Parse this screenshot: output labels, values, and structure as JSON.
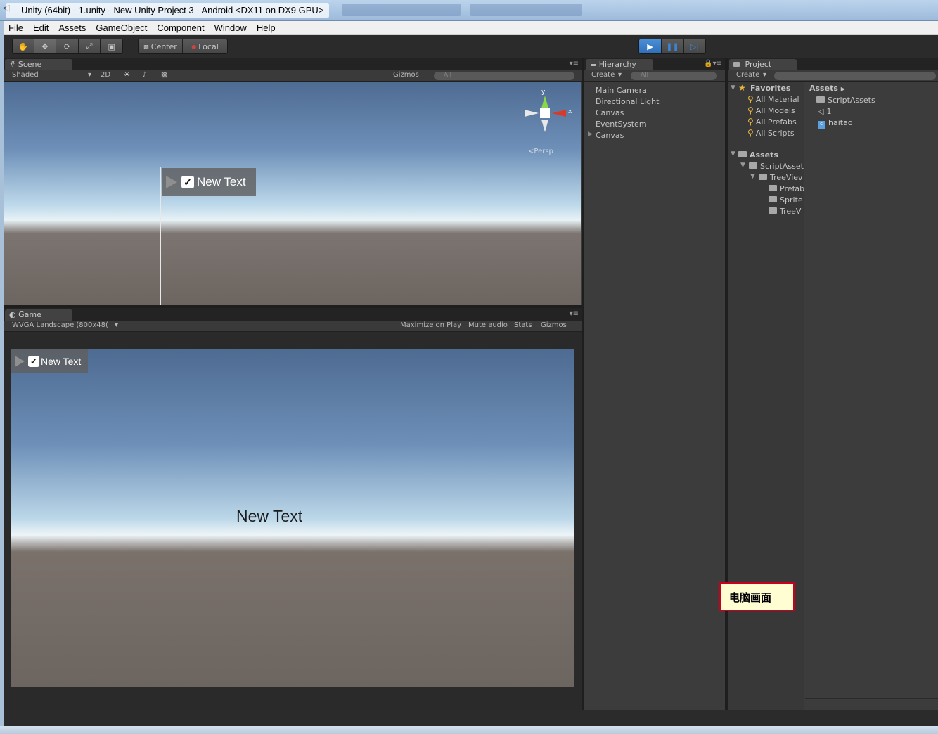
{
  "window": {
    "title": "Unity (64bit) - 1.unity - New Unity Project 3 - Android <DX11 on DX9 GPU>"
  },
  "menu": [
    "File",
    "Edit",
    "Assets",
    "GameObject",
    "Component",
    "Window",
    "Help"
  ],
  "toolbar": {
    "pivot_label": "Center",
    "space_label": "Local"
  },
  "scene": {
    "tab_label": "Scene",
    "shading": "Shaded",
    "mode_2d": "2D",
    "gizmos": "Gizmos",
    "search_placeholder": "All",
    "persp_label": "Persp",
    "gizmo_y": "y",
    "gizmo_x": "x",
    "ui_text": "New Text"
  },
  "game": {
    "tab_label": "Game",
    "resolution": "WVGA Landscape (800x48(",
    "maximize": "Maximize on Play",
    "mute": "Mute audio",
    "stats": "Stats",
    "gizmos": "Gizmos",
    "chip_text": "New Text",
    "center_text": "New Text"
  },
  "hierarchy": {
    "tab_label": "Hierarchy",
    "create_label": "Create",
    "search_placeholder": "All",
    "items": [
      "Main Camera",
      "Directional Light",
      "Canvas",
      "EventSystem",
      "Canvas"
    ]
  },
  "project": {
    "tab_label": "Project",
    "create_label": "Create",
    "favorites_label": "Favorites",
    "favorites": [
      "All Material",
      "All Models",
      "All Prefabs",
      "All Scripts"
    ],
    "assets_label": "Assets",
    "tree": [
      "ScriptAsset",
      "TreeViev",
      "Prefab",
      "Sprite",
      "TreeV"
    ],
    "breadcrumb": "Assets",
    "files": [
      "ScriptAssets",
      "1",
      "haitao"
    ]
  },
  "annotation": "电脑画面",
  "colors": {
    "play_blue": "#2e6fb8",
    "panel_bg": "#3c3c3c",
    "annotation_border": "#c8001e",
    "annotation_bg": "#fffed2"
  }
}
